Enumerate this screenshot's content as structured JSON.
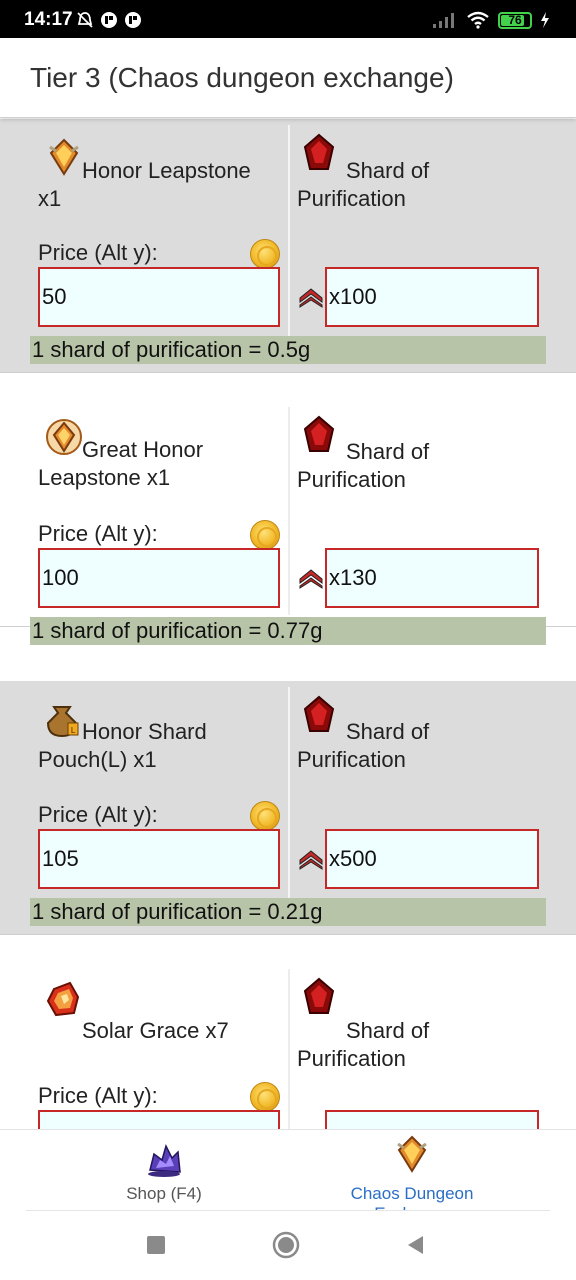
{
  "status": {
    "time": "14:17",
    "battery": "76",
    "icons": [
      "mute-icon",
      "notification-icon",
      "notification-icon",
      "signal-icon",
      "wifi-icon",
      "battery-icon",
      "charging-icon"
    ]
  },
  "header": {
    "title": "Tier 3 (Chaos dungeon exchange)"
  },
  "cards": [
    {
      "item_name_line1": "Honor Leapstone",
      "item_name_line2": "x1",
      "item_icon": "honor-leapstone-icon",
      "shard_name_line1": "Shard of",
      "shard_name_line2": "Purification",
      "price_label": "Price (Alt y):",
      "price_value": "50",
      "qty_value": "x100",
      "ratio_text": "1 shard of purification = 0.5g"
    },
    {
      "item_name_line1": "Great Honor",
      "item_name_line2": "Leapstone x1",
      "item_icon": "great-honor-leapstone-icon",
      "shard_name_line1": "Shard of",
      "shard_name_line2": "Purification",
      "price_label": "Price (Alt y):",
      "price_value": "100",
      "qty_value": "x130",
      "ratio_text": "1 shard of purification = 0.77g"
    },
    {
      "item_name_line1": "Honor Shard",
      "item_name_line2": "Pouch(L) x1",
      "item_icon": "honor-shard-pouch-icon",
      "shard_name_line1": "Shard of",
      "shard_name_line2": "Purification",
      "price_label": "Price (Alt y):",
      "price_value": "105",
      "qty_value": "x500",
      "ratio_text": "1 shard of purification = 0.21g"
    },
    {
      "item_name_line1": "Solar Grace x7",
      "item_name_line2": "",
      "item_icon": "solar-grace-icon",
      "shard_name_line1": "Shard of",
      "shard_name_line2": "Purification",
      "price_label": "Price (Alt y):",
      "price_value": "",
      "qty_value": "",
      "ratio_text": ""
    }
  ],
  "bottom_nav": {
    "items": [
      {
        "label": "Shop (F4)",
        "icon": "shop-icon",
        "active": false
      },
      {
        "label_line1": "Chaos Dungeon",
        "label_line2": "Exchange",
        "icon": "chaos-dungeon-icon",
        "active": true
      }
    ]
  },
  "colors": {
    "input_border": "#c62828",
    "input_bg": "#efffff",
    "ratio_bg": "#b8c4a8",
    "card_grey": "#dcdcdc",
    "active_tab": "#2a6ec6"
  }
}
